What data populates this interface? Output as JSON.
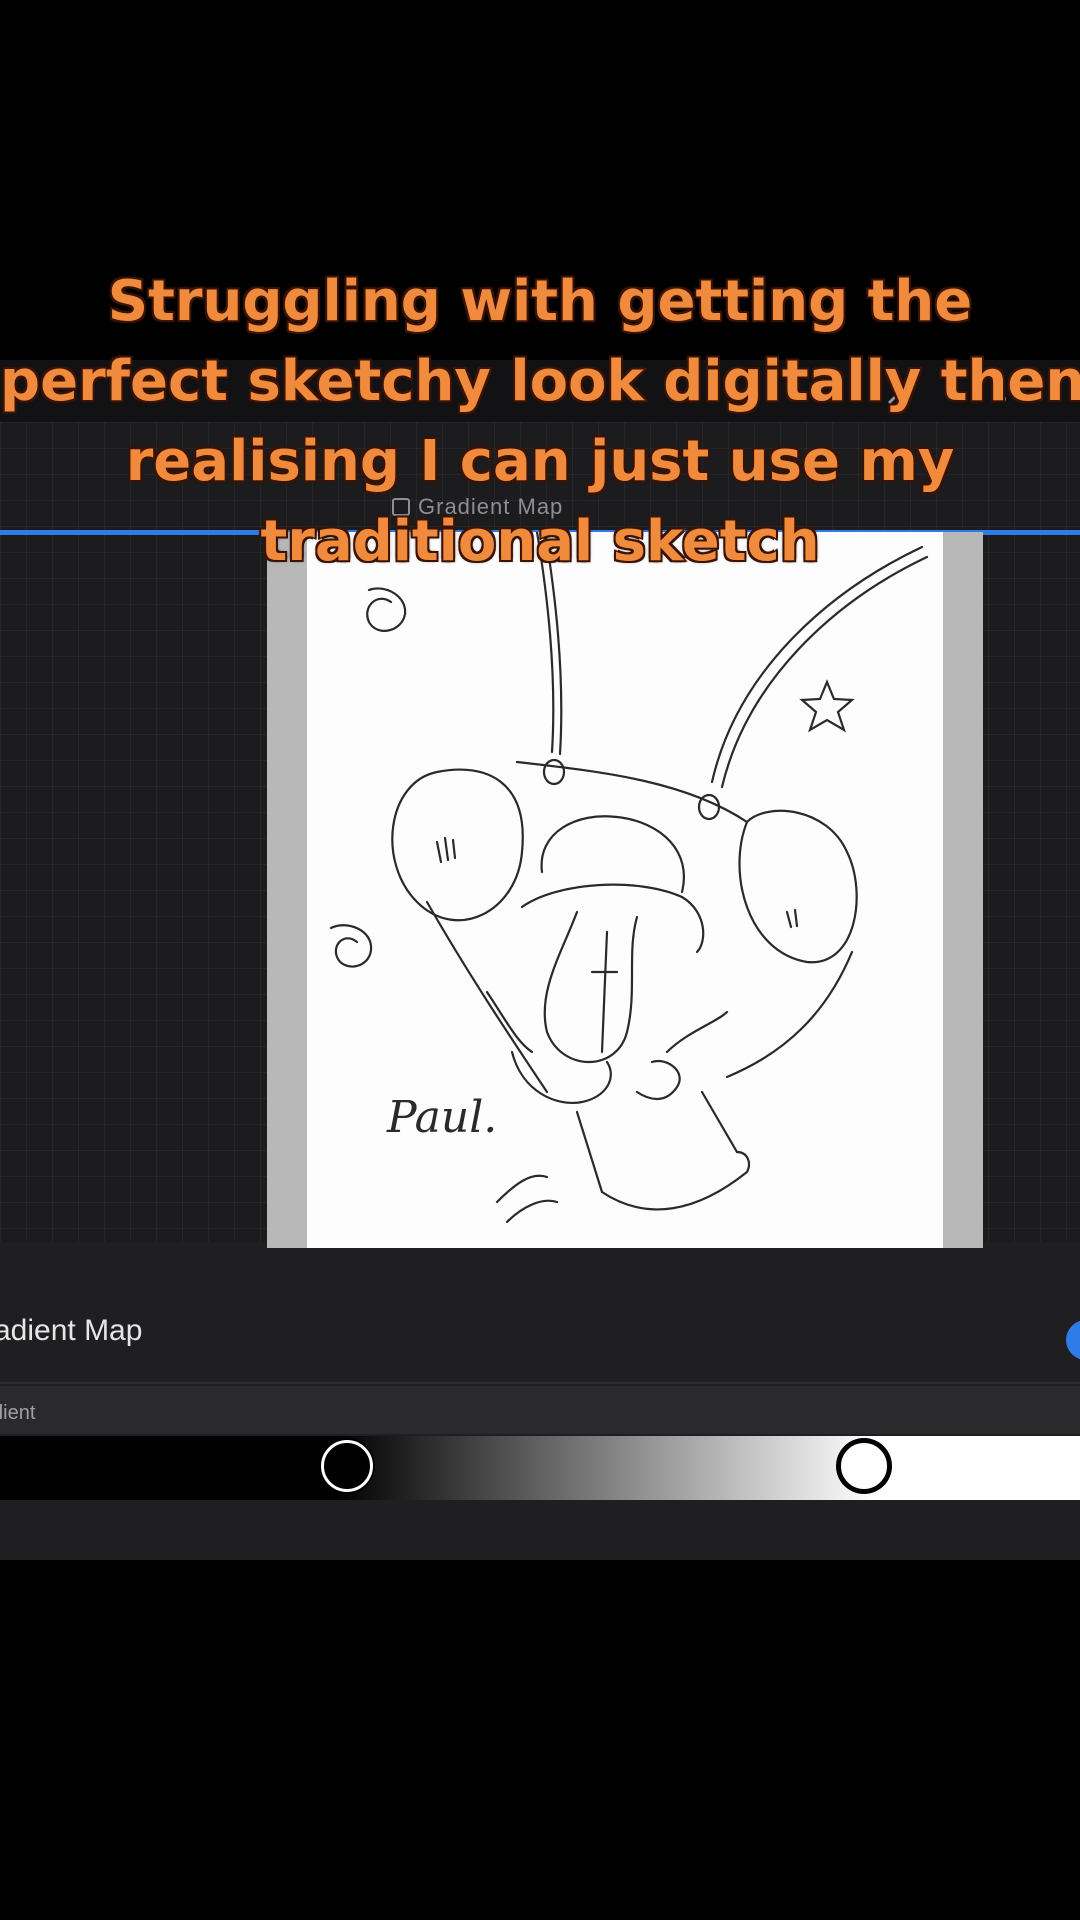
{
  "caption": {
    "lines": [
      "Struggling with getting the",
      "perfect sketchy look digitally then",
      "realising I can just use my",
      "traditional sketch"
    ]
  },
  "app": {
    "layer_label": "Gradient Map",
    "panel_title": "radient Map",
    "gradient_label": "dient",
    "gradient_stops": [
      {
        "color": "#000000",
        "position": 0.31
      },
      {
        "color": "#ffffff",
        "position": 0.81
      }
    ],
    "accent_color": "#2f7be8"
  },
  "artwork": {
    "signature": "Paul."
  }
}
